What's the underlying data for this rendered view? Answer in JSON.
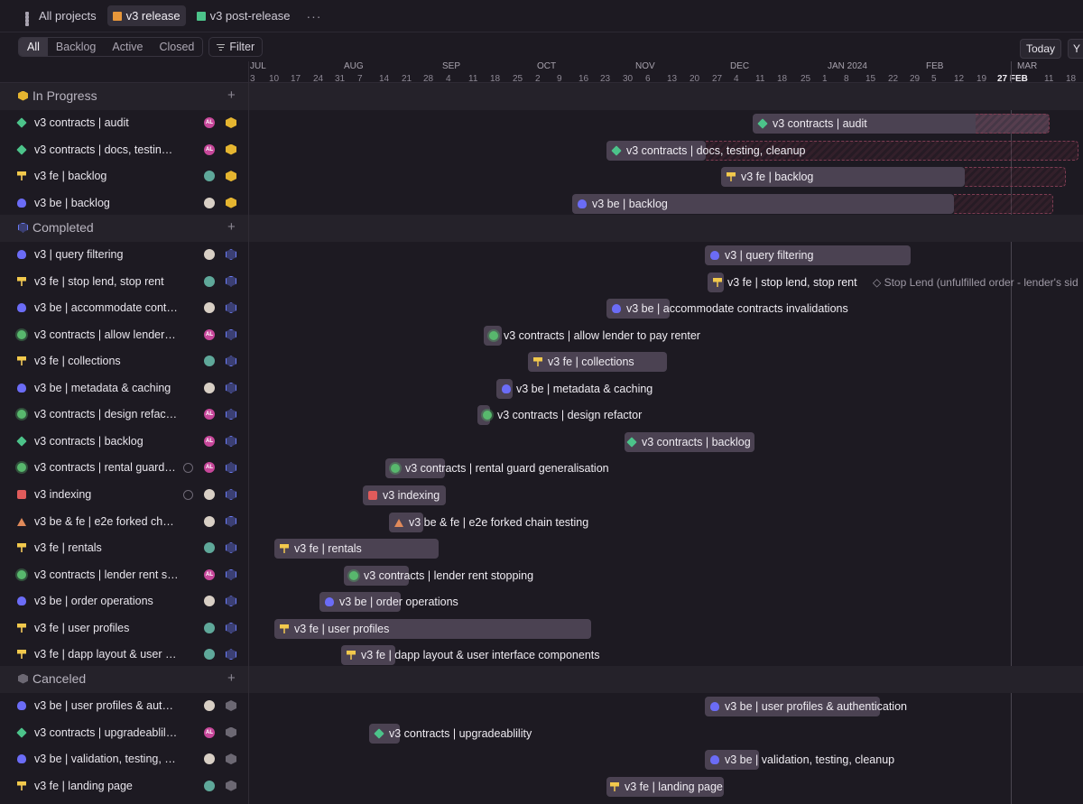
{
  "breadcrumbs": [
    {
      "label": "All projects",
      "icon": "grid-icon",
      "active": false
    },
    {
      "label": "v3 release",
      "icon": "map-icon-orange",
      "active": true
    },
    {
      "label": "v3 post-release",
      "icon": "map-icon-green",
      "active": false
    }
  ],
  "more_label": "···",
  "filters": {
    "tabs": [
      "All",
      "Backlog",
      "Active",
      "Closed"
    ],
    "selected": "All",
    "filter_label": "Filter"
  },
  "today_label": "Today",
  "year_label": "Y",
  "timeline": {
    "months": [
      "JUL",
      "AUG",
      "SEP",
      "OCT",
      "NOV",
      "DEC",
      "JAN 2024",
      "FEB",
      "MAR"
    ],
    "days": [
      "3",
      "10",
      "17",
      "24",
      "31",
      "7",
      "14",
      "21",
      "28",
      "4",
      "11",
      "18",
      "25",
      "2",
      "9",
      "16",
      "23",
      "30",
      "6",
      "13",
      "20",
      "27",
      "4",
      "11",
      "18",
      "25",
      "1",
      "8",
      "15",
      "22",
      "29",
      "5",
      "12",
      "19",
      "27 FEB",
      "11",
      "18"
    ],
    "today_label": "27 FEB"
  },
  "colors": {
    "background": "#1d1a22",
    "group_bg": "#25222a",
    "bar": "#4b4252",
    "in_progress": "#e5b530",
    "completed": "#6b7cf6"
  },
  "groups": [
    {
      "label": "In Progress",
      "status_icon": "in-progress-icon",
      "add": "+",
      "rows": [
        {
          "name": "v3 contracts | audit",
          "bar_label": "v3 contracts | audit",
          "icon": "diamond",
          "avatar": "AL",
          "status": "prog"
        },
        {
          "name": "v3 contracts | docs, testin…",
          "bar_label": "v3 contracts | docs, testing, cleanup",
          "icon": "diamond",
          "avatar": "AL",
          "status": "prog"
        },
        {
          "name": "v3 fe | backlog",
          "bar_label": "v3 fe | backlog",
          "icon": "hammer",
          "avatar": "cat",
          "status": "prog"
        },
        {
          "name": "v3 be | backlog",
          "bar_label": "v3 be | backlog",
          "icon": "skull",
          "avatar": "face",
          "status": "prog"
        }
      ]
    },
    {
      "label": "Completed",
      "status_icon": "completed-icon",
      "add": "+",
      "rows": [
        {
          "name": "v3 | query filtering",
          "bar_label": "v3 | query filtering",
          "icon": "skull",
          "avatar": "face",
          "status": "done"
        },
        {
          "name": "v3 fe | stop lend, stop rent",
          "bar_label": "v3 fe | stop lend, stop rent",
          "icon": "hammer",
          "avatar": "cat",
          "status": "done",
          "milestone": "Stop Lend (unfulfilled order - lender's sid"
        },
        {
          "name": "v3 be | accommodate cont…",
          "bar_label": "v3 be | accommodate contracts invalidations",
          "icon": "skull",
          "avatar": "face",
          "status": "done"
        },
        {
          "name": "v3 contracts | allow lender…",
          "bar_label": "v3 contracts | allow lender to pay renter",
          "icon": "gear",
          "avatar": "AL",
          "status": "done"
        },
        {
          "name": "v3 fe | collections",
          "bar_label": "v3 fe | collections",
          "icon": "hammer",
          "avatar": "cat",
          "status": "done"
        },
        {
          "name": "v3 be | metadata & caching",
          "bar_label": "v3 be | metadata & caching",
          "icon": "skull",
          "avatar": "face",
          "status": "done"
        },
        {
          "name": "v3 contracts | design refac…",
          "bar_label": "v3 contracts | design refactor",
          "icon": "gear",
          "avatar": "AL",
          "status": "done"
        },
        {
          "name": "v3 contracts | backlog",
          "bar_label": "v3 contracts | backlog",
          "icon": "diamond",
          "avatar": "AL",
          "status": "done"
        },
        {
          "name": "v3 contracts | rental guard…",
          "bar_label": "v3 contracts | rental guard generalisation",
          "icon": "gear",
          "avatar": "AL",
          "status": "done",
          "extra": true
        },
        {
          "name": "v3 indexing",
          "bar_label": "v3 indexing",
          "icon": "camera",
          "avatar": "face",
          "status": "done",
          "extra": true
        },
        {
          "name": "v3 be & fe | e2e forked cha…",
          "bar_label": "v3 be & fe | e2e forked chain testing",
          "icon": "recycle",
          "avatar": "face",
          "status": "done"
        },
        {
          "name": "v3 fe | rentals",
          "bar_label": "v3 fe | rentals",
          "icon": "hammer",
          "avatar": "cat",
          "status": "done"
        },
        {
          "name": "v3 contracts | lender rent s…",
          "bar_label": "v3 contracts | lender rent stopping",
          "icon": "gear",
          "avatar": "AL",
          "status": "done"
        },
        {
          "name": "v3 be | order operations",
          "bar_label": "v3 be | order operations",
          "icon": "skull",
          "avatar": "face",
          "status": "done"
        },
        {
          "name": "v3 fe | user profiles",
          "bar_label": "v3 fe | user profiles",
          "icon": "hammer",
          "avatar": "cat",
          "status": "done"
        },
        {
          "name": "v3 fe | dapp layout & user i…",
          "bar_label": "v3 fe | dapp layout & user interface components",
          "icon": "hammer",
          "avatar": "cat",
          "status": "done"
        }
      ]
    },
    {
      "label": "Canceled",
      "status_icon": "canceled-icon",
      "add": "+",
      "rows": [
        {
          "name": "v3 be | user profiles & auth…",
          "bar_label": "v3 be | user profiles & authentication",
          "icon": "skull",
          "avatar": "face",
          "status": "cancel"
        },
        {
          "name": "v3 contracts | upgradeablil…",
          "bar_label": "v3 contracts | upgradeablility",
          "icon": "diamond",
          "avatar": "AL",
          "status": "cancel"
        },
        {
          "name": "v3 be | validation, testing, …",
          "bar_label": "v3 be | validation, testing, cleanup",
          "icon": "skull",
          "avatar": "face",
          "status": "cancel"
        },
        {
          "name": "v3 fe | landing page",
          "bar_label": "v3 fe | landing page",
          "icon": "hammer",
          "avatar": "cat",
          "status": "cancel"
        }
      ]
    }
  ]
}
